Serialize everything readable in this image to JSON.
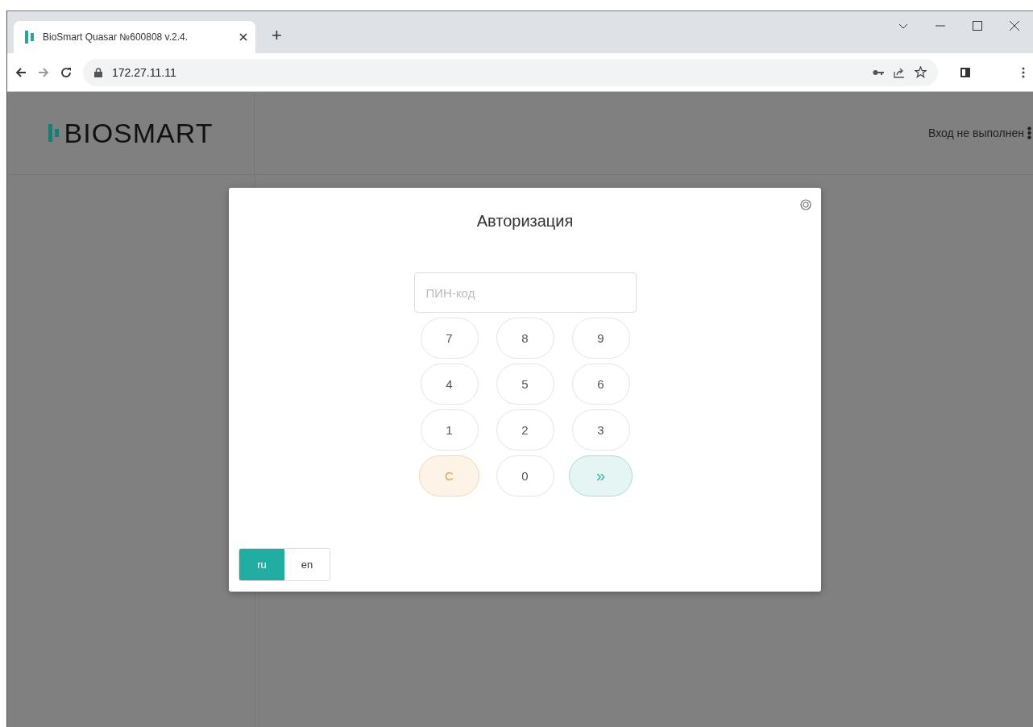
{
  "browser": {
    "tab_title": "BioSmart Quasar №600808 v.2.4.",
    "new_tab": "+",
    "url": "172.27.11.11"
  },
  "header": {
    "logo": "BIOSMART",
    "status": "Вход не выполнен"
  },
  "dialog": {
    "title": "Авторизация",
    "pin": {
      "placeholder": "ПИН-код"
    },
    "keys": [
      {
        "label": "7",
        "kind": "digit"
      },
      {
        "label": "8",
        "kind": "digit"
      },
      {
        "label": "9",
        "kind": "digit"
      },
      {
        "label": "4",
        "kind": "digit"
      },
      {
        "label": "5",
        "kind": "digit"
      },
      {
        "label": "6",
        "kind": "digit"
      },
      {
        "label": "1",
        "kind": "digit"
      },
      {
        "label": "2",
        "kind": "digit"
      },
      {
        "label": "3",
        "kind": "digit"
      },
      {
        "label": "C",
        "kind": "clear"
      },
      {
        "label": "0",
        "kind": "digit"
      },
      {
        "label": "»",
        "kind": "enter"
      }
    ],
    "languages": [
      {
        "label": "ru",
        "selected": true
      },
      {
        "label": "en",
        "selected": false
      }
    ]
  }
}
